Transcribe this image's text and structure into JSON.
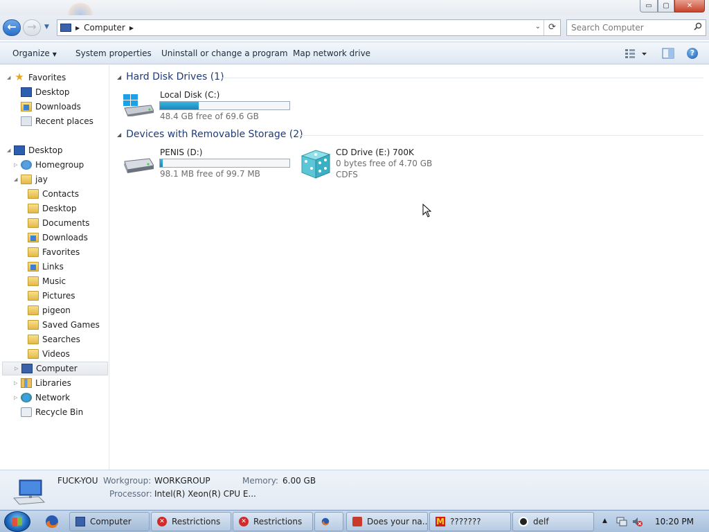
{
  "window": {
    "controls": {
      "minimize": "▭",
      "maximize": "▢",
      "close": "✕"
    }
  },
  "address": {
    "breadcrumb": "Computer",
    "search_placeholder": "Search Computer",
    "refresh": "⟳",
    "dropdown": "⌄"
  },
  "toolbar": {
    "organize": "Organize",
    "system_properties": "System properties",
    "uninstall": "Uninstall or change a program",
    "map_drive": "Map network drive",
    "help": "?"
  },
  "nav": {
    "items": [
      {
        "label": "Favorites",
        "icon": "star-icon"
      },
      {
        "label": "Desktop",
        "icon": "desktop-icon"
      },
      {
        "label": "Downloads",
        "icon": "downloads-folder-icon"
      },
      {
        "label": "Recent places",
        "icon": "recent-places-icon"
      },
      {
        "label": "Desktop",
        "icon": "desktop-icon"
      },
      {
        "label": "Homegroup",
        "icon": "homegroup-icon"
      },
      {
        "label": "jay",
        "icon": "user-folder-icon"
      },
      {
        "label": "Contacts",
        "icon": "folder-icon"
      },
      {
        "label": "Desktop",
        "icon": "folder-icon"
      },
      {
        "label": "Documents",
        "icon": "folder-icon"
      },
      {
        "label": "Downloads",
        "icon": "folder-icon"
      },
      {
        "label": "Favorites",
        "icon": "folder-icon"
      },
      {
        "label": "Links",
        "icon": "folder-icon"
      },
      {
        "label": "Music",
        "icon": "folder-icon"
      },
      {
        "label": "Pictures",
        "icon": "folder-icon"
      },
      {
        "label": "pigeon",
        "icon": "folder-icon"
      },
      {
        "label": "Saved Games",
        "icon": "folder-icon"
      },
      {
        "label": "Searches",
        "icon": "folder-icon"
      },
      {
        "label": "Videos",
        "icon": "folder-icon"
      },
      {
        "label": "Computer",
        "icon": "computer-icon"
      },
      {
        "label": "Libraries",
        "icon": "libraries-icon"
      },
      {
        "label": "Network",
        "icon": "network-icon"
      },
      {
        "label": "Recycle Bin",
        "icon": "recycle-bin-icon"
      }
    ]
  },
  "groups": {
    "hdd": {
      "title": "Hard Disk Drives (1)"
    },
    "removable": {
      "title": "Devices with Removable Storage (2)"
    }
  },
  "drives": {
    "c": {
      "name": "Local Disk (C:)",
      "free": "48.4 GB free of 69.6 GB",
      "used_fraction": 0.3
    },
    "d": {
      "name": "PENIS (D:)",
      "free": "98.1 MB free of 99.7 MB",
      "used_fraction": 0.02
    },
    "e": {
      "name": "CD Drive (E:) 700K",
      "free": "0 bytes free of 4.70 GB",
      "fs": "CDFS"
    }
  },
  "details": {
    "computer_name": "FUCK-YOU",
    "workgroup_label": "Workgroup:",
    "workgroup": "WORKGROUP",
    "memory_label": "Memory:",
    "memory": "6.00 GB",
    "processor_label": "Processor:",
    "processor": "Intel(R) Xeon(R) CPU E..."
  },
  "taskbar": {
    "buttons": [
      {
        "label": "Computer"
      },
      {
        "label": "Restrictions"
      },
      {
        "label": "Restrictions"
      },
      {
        "label": "Does your na..."
      },
      {
        "label": "???????"
      },
      {
        "label": "delf"
      }
    ],
    "clock": "10:20 PM"
  },
  "colors": {
    "accent": "#1e3a78",
    "bar_fill": "#26a0d4",
    "close_button": "#c8442c"
  }
}
